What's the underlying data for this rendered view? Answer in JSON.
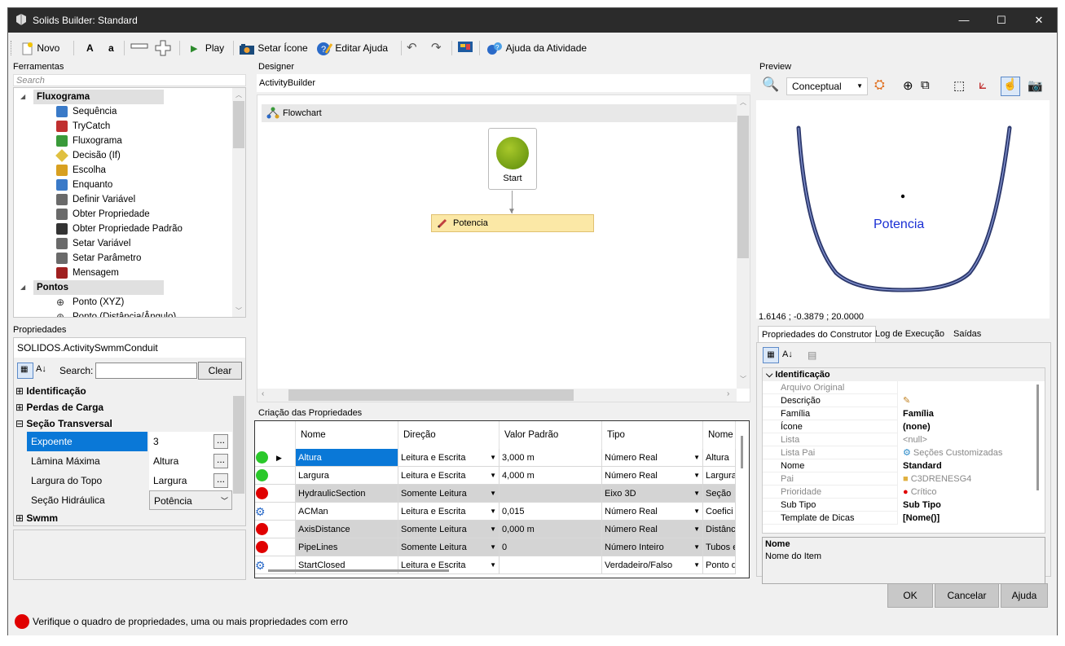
{
  "window": {
    "title": "Solids Builder: Standard",
    "minimize": "—",
    "maximize": "☐",
    "close": "✕"
  },
  "toolbar": {
    "novo": "Novo",
    "bold_a": "A",
    "small_a": "a",
    "play": "Play",
    "setar_icone": "Setar Ícone",
    "editar_ajuda": "Editar Ajuda",
    "ajuda_atividade": "Ajuda da Atividade"
  },
  "ferramentas": {
    "title": "Ferramentas",
    "search_placeholder": "Search",
    "groups": [
      {
        "label": "Fluxograma",
        "items": [
          "Sequência",
          "TryCatch",
          "Fluxograma",
          "Decisão (If)",
          "Escolha",
          "Enquanto",
          "Definir Variável",
          "Obter Propriedade",
          "Obter Propriedade Padrão",
          "Setar Variável",
          "Setar Parâmetro",
          "Mensagem"
        ]
      },
      {
        "label": "Pontos",
        "items": [
          "Ponto (XYZ)",
          "Ponto (Distância/Ângulo)"
        ]
      }
    ]
  },
  "propriedades": {
    "title": "Propriedades",
    "object": "SOLIDOS.ActivitySwmmConduit",
    "search_label": "Search:",
    "clear": "Clear",
    "categories": {
      "identificacao": "Identificação",
      "perdas": "Perdas de Carga",
      "secao": "Seção Transversal",
      "swmm": "Swmm"
    },
    "rows": [
      {
        "name": "Expoente",
        "value": "3"
      },
      {
        "name": "Lâmina Máxima",
        "value": "Altura"
      },
      {
        "name": "Largura do Topo",
        "value": "Largura"
      },
      {
        "name": "Seção Hidráulica",
        "value": "Potência"
      }
    ]
  },
  "designer": {
    "title": "Designer",
    "breadcrumb": "ActivityBuilder",
    "flowchart": "Flowchart",
    "start": "Start",
    "activity": "Potencia"
  },
  "criacao": {
    "title": "Criação das Propriedades",
    "headers": [
      "Nome",
      "Direção",
      "Valor Padrão",
      "Tipo",
      "Nome"
    ],
    "rows": [
      {
        "status": "green",
        "nome": "Altura",
        "direcao": "Leitura e Escrita",
        "valor": "3,000 m",
        "tipo": "Número Real",
        "nome2": "Altura"
      },
      {
        "status": "green",
        "nome": "Largura",
        "direcao": "Leitura e Escrita",
        "valor": "4,000 m",
        "tipo": "Número Real",
        "nome2": "Largura"
      },
      {
        "status": "red",
        "nome": "HydraulicSection",
        "direcao": "Somente Leitura",
        "valor": "",
        "tipo": "Eixo 3D",
        "nome2": "Seção"
      },
      {
        "status": "gear",
        "nome": "ACMan",
        "direcao": "Leitura e Escrita",
        "valor": "0,015",
        "tipo": "Número Real",
        "nome2": "Coefici"
      },
      {
        "status": "red",
        "nome": "AxisDistance",
        "direcao": "Somente Leitura",
        "valor": "0,000 m",
        "tipo": "Número Real",
        "nome2": "Distânc"
      },
      {
        "status": "red",
        "nome": "PipeLines",
        "direcao": "Somente Leitura",
        "valor": "0",
        "tipo": "Número Inteiro",
        "nome2": "Tubos e"
      },
      {
        "status": "gear",
        "nome": "StartClosed",
        "direcao": "Leitura e Escrita",
        "valor": "",
        "tipo": "Verdadeiro/Falso",
        "nome2": "Ponto d"
      }
    ]
  },
  "preview": {
    "title": "Preview",
    "view_mode": "Conceptual",
    "label": "Potencia",
    "coords": "1.6146 ; -0.3879 ; 20.0000",
    "colors": {
      "curve": "#2e3a6e",
      "label": "#1a2fd4"
    }
  },
  "construtor": {
    "tabs": [
      "Propriedades do Construtor",
      "Log de Execução",
      "Saídas"
    ],
    "category": "Identificação",
    "rows": [
      {
        "name": "Arquivo Original",
        "value": "",
        "disabled": true
      },
      {
        "name": "Descrição",
        "value": "",
        "disabled": false
      },
      {
        "name": "Família",
        "value": "Família",
        "disabled": false,
        "bold": true
      },
      {
        "name": "Ícone",
        "value": "(none)",
        "disabled": false,
        "bold": true
      },
      {
        "name": "Lista",
        "value": "<null>",
        "disabled": true
      },
      {
        "name": "Lista Pai",
        "value": "Seções Customizadas",
        "disabled": true
      },
      {
        "name": "Nome",
        "value": "Standard",
        "disabled": false,
        "bold": true
      },
      {
        "name": "Pai",
        "value": "C3DRENESG4",
        "disabled": true
      },
      {
        "name": "Prioridade",
        "value": "Crítico",
        "disabled": true
      },
      {
        "name": "Sub Tipo",
        "value": "Sub Tipo",
        "disabled": false,
        "bold": true
      },
      {
        "name": "Template de Dicas",
        "value": "[Nome()]",
        "disabled": false,
        "bold": true
      }
    ],
    "desc_title": "Nome",
    "desc_text": "Nome do Item"
  },
  "buttons": {
    "ok": "OK",
    "cancel": "Cancelar",
    "help": "Ajuda"
  },
  "status": {
    "message": "Verifique o quadro de propriedades, uma ou mais propriedades com erro"
  }
}
